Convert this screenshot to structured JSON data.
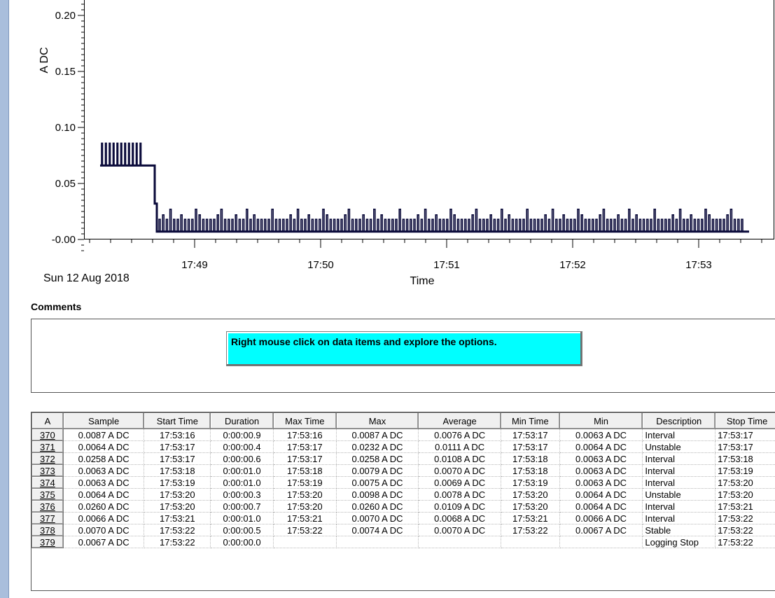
{
  "chart_data": {
    "type": "line",
    "ylabel": "A DC",
    "xlabel": "Time",
    "date_label": "Sun 12 Aug 2018",
    "y_ticks": [
      "-0.00",
      "0.05",
      "0.10",
      "0.15",
      "0.20"
    ],
    "x_ticks": [
      "17:49",
      "17:50",
      "17:51",
      "17:52",
      "17:53"
    ],
    "series": [
      {
        "values_description_hidden": true,
        "x": [
          "17:48:15",
          "17:48:38",
          "17:48:41",
          "17:48:42",
          "17:53:24"
        ],
        "y": [
          0.066,
          0.066,
          0.032,
          0.007,
          0.007
        ]
      }
    ],
    "ylim": [
      -0.01,
      0.225
    ],
    "line_color": "#0a0a3a"
  },
  "comments": {
    "title": "Comments",
    "hint": "Right mouse click on data items and explore the options."
  },
  "table": {
    "columns": [
      "A",
      "Sample",
      "Start Time",
      "Duration",
      "Max Time",
      "Max",
      "Average",
      "Min Time",
      "Min",
      "Description",
      "Stop Time"
    ],
    "rows": [
      [
        "370",
        "0.0087 A DC",
        "17:53:16",
        "0:00:00.9",
        "17:53:16",
        "0.0087 A DC",
        "0.0076 A DC",
        "17:53:17",
        "0.0063 A DC",
        "Interval",
        "17:53:17"
      ],
      [
        "371",
        "0.0064 A DC",
        "17:53:17",
        "0:00:00.4",
        "17:53:17",
        "0.0232 A DC",
        "0.0111 A DC",
        "17:53:17",
        "0.0064 A DC",
        "Unstable",
        "17:53:17"
      ],
      [
        "372",
        "0.0258 A DC",
        "17:53:17",
        "0:00:00.6",
        "17:53:17",
        "0.0258 A DC",
        "0.0108 A DC",
        "17:53:18",
        "0.0063 A DC",
        "Interval",
        "17:53:18"
      ],
      [
        "373",
        "0.0063 A DC",
        "17:53:18",
        "0:00:01.0",
        "17:53:18",
        "0.0079 A DC",
        "0.0070 A DC",
        "17:53:18",
        "0.0063 A DC",
        "Interval",
        "17:53:19"
      ],
      [
        "374",
        "0.0063 A DC",
        "17:53:19",
        "0:00:01.0",
        "17:53:19",
        "0.0075 A DC",
        "0.0069 A DC",
        "17:53:19",
        "0.0063 A DC",
        "Interval",
        "17:53:20"
      ],
      [
        "375",
        "0.0064 A DC",
        "17:53:20",
        "0:00:00.3",
        "17:53:20",
        "0.0098 A DC",
        "0.0078 A DC",
        "17:53:20",
        "0.0064 A DC",
        "Unstable",
        "17:53:20"
      ],
      [
        "376",
        "0.0260 A DC",
        "17:53:20",
        "0:00:00.7",
        "17:53:20",
        "0.0260 A DC",
        "0.0109 A DC",
        "17:53:20",
        "0.0064 A DC",
        "Interval",
        "17:53:21"
      ],
      [
        "377",
        "0.0066 A DC",
        "17:53:21",
        "0:00:01.0",
        "17:53:21",
        "0.0070 A DC",
        "0.0068 A DC",
        "17:53:21",
        "0.0066 A DC",
        "Interval",
        "17:53:22"
      ],
      [
        "378",
        "0.0070 A DC",
        "17:53:22",
        "0:00:00.5",
        "17:53:22",
        "0.0074 A DC",
        "0.0070 A DC",
        "17:53:22",
        "0.0067 A DC",
        "Stable",
        "17:53:22"
      ],
      [
        "379",
        "0.0067 A DC",
        "17:53:22",
        "0:00:00.0",
        "",
        "",
        "",
        "",
        "",
        "Logging Stop",
        "17:53:22"
      ]
    ]
  }
}
